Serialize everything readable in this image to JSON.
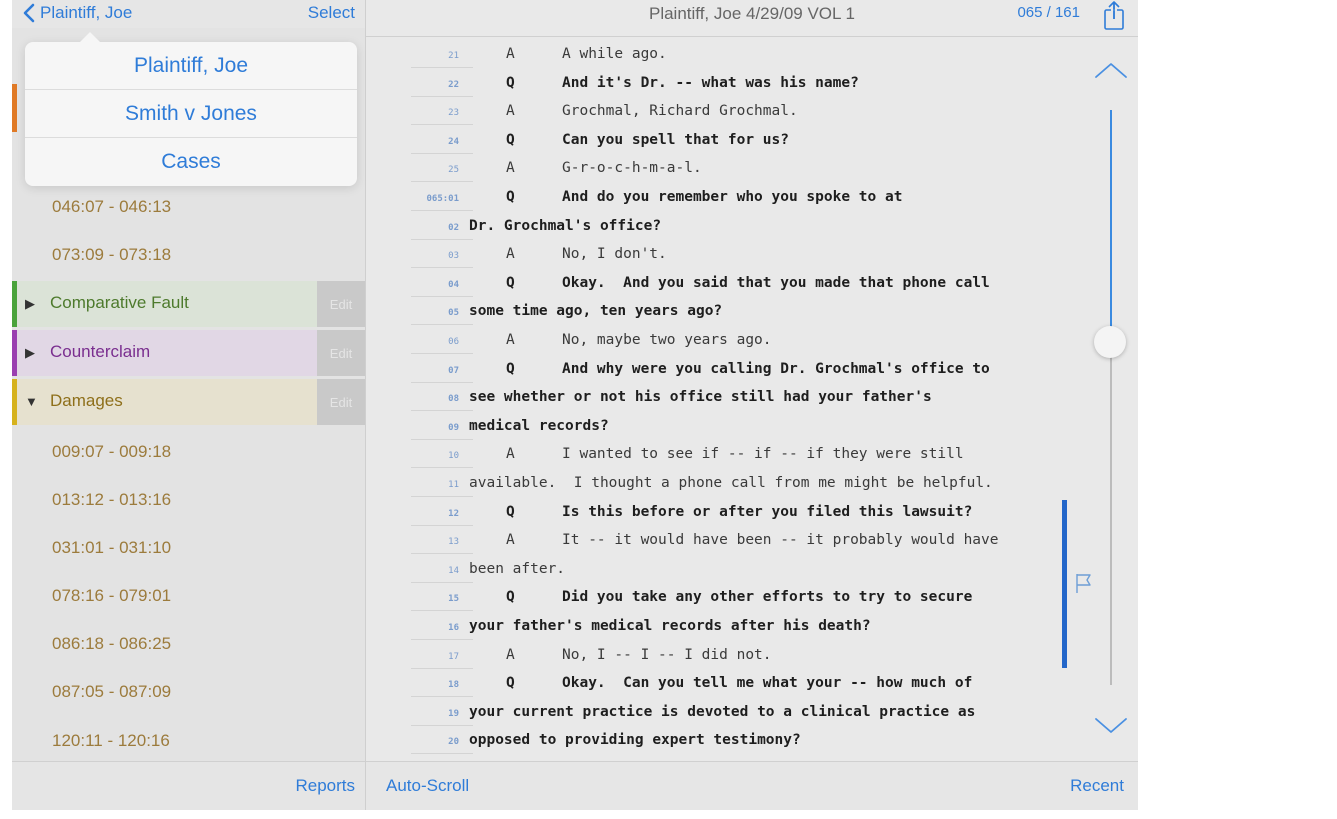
{
  "colors": {
    "accent": "#2f7cd8",
    "range_text": "#9c7b3c",
    "comparative_fault": "#4aa33b",
    "counterclaim": "#9a3fb0",
    "damages": "#d6b21d",
    "orange_marker": "#e07a26",
    "mark_bar": "#2366c9"
  },
  "sidebar": {
    "back_label": "Plaintiff, Joe",
    "select_label": "Select",
    "popover": {
      "items": [
        "Plaintiff, Joe",
        "Smith v Jones",
        "Cases"
      ]
    },
    "ranges_top": [
      "046:07 - 046:13",
      "073:09 - 073:18"
    ],
    "groups": [
      {
        "label": "Comparative Fault",
        "expanded": false,
        "edit": "Edit",
        "color": "#4aa33b"
      },
      {
        "label": "Counterclaim",
        "expanded": false,
        "edit": "Edit",
        "color": "#9a3fb0"
      },
      {
        "label": "Damages",
        "expanded": true,
        "edit": "Edit",
        "color": "#d6b21d"
      }
    ],
    "damages_ranges": [
      "009:07 - 009:18",
      "013:12 - 013:16",
      "031:01 - 031:10",
      "078:16 - 079:01",
      "086:18 - 086:25",
      "087:05 - 087:09",
      "120:11 - 120:16"
    ],
    "reports_label": "Reports"
  },
  "main": {
    "title": "Plaintiff, Joe 4/29/09 VOL 1",
    "page_counter": "065 / 161",
    "auto_scroll_label": "Auto-Scroll",
    "recent_label": "Recent",
    "scroll_position": 0.4,
    "lines": [
      {
        "ln": "21",
        "speaker": "A",
        "text": "A while ago.",
        "type": "a"
      },
      {
        "ln": "22",
        "speaker": "Q",
        "text": "And it's Dr. -- what was his name?",
        "type": "q"
      },
      {
        "ln": "23",
        "speaker": "A",
        "text": "Grochmal, Richard Grochmal.",
        "type": "a"
      },
      {
        "ln": "24",
        "speaker": "Q",
        "text": "Can you spell that for us?",
        "type": "q"
      },
      {
        "ln": "25",
        "speaker": "A",
        "text": "G-r-o-c-h-m-a-l.",
        "type": "a"
      },
      {
        "ln": "065:01",
        "speaker": "Q",
        "text": "And do you remember who you spoke to at",
        "type": "q"
      },
      {
        "ln": "02",
        "speaker": "",
        "text": "Dr. Grochmal's office?",
        "type": "q"
      },
      {
        "ln": "03",
        "speaker": "A",
        "text": "No, I don't.",
        "type": "a"
      },
      {
        "ln": "04",
        "speaker": "Q",
        "text": "Okay.  And you said that you made that phone call",
        "type": "q"
      },
      {
        "ln": "05",
        "speaker": "",
        "text": "some time ago, ten years ago?",
        "type": "q"
      },
      {
        "ln": "06",
        "speaker": "A",
        "text": "No, maybe two years ago.",
        "type": "a"
      },
      {
        "ln": "07",
        "speaker": "Q",
        "text": "And why were you calling Dr. Grochmal's office to",
        "type": "q"
      },
      {
        "ln": "08",
        "speaker": "",
        "text": "see whether or not his office still had your father's",
        "type": "q"
      },
      {
        "ln": "09",
        "speaker": "",
        "text": "medical records?",
        "type": "q"
      },
      {
        "ln": "10",
        "speaker": "A",
        "text": "I wanted to see if -- if -- if they were still",
        "type": "a"
      },
      {
        "ln": "11",
        "speaker": "",
        "text": "available.  I thought a phone call from me might be helpful.",
        "type": "a"
      },
      {
        "ln": "12",
        "speaker": "Q",
        "text": "Is this before or after you filed this lawsuit?",
        "type": "q"
      },
      {
        "ln": "13",
        "speaker": "A",
        "text": "It -- it would have been -- it probably would have",
        "type": "a"
      },
      {
        "ln": "14",
        "speaker": "",
        "text": "been after.",
        "type": "a"
      },
      {
        "ln": "15",
        "speaker": "Q",
        "text": "Did you take any other efforts to try to secure",
        "type": "q"
      },
      {
        "ln": "16",
        "speaker": "",
        "text": "your father's medical records after his death?",
        "type": "q"
      },
      {
        "ln": "17",
        "speaker": "A",
        "text": "No, I -- I -- I did not.",
        "type": "a"
      },
      {
        "ln": "18",
        "speaker": "Q",
        "text": "Okay.  Can you tell me what your -- how much of",
        "type": "q"
      },
      {
        "ln": "19",
        "speaker": "",
        "text": "your current practice is devoted to a clinical practice as",
        "type": "q"
      },
      {
        "ln": "20",
        "speaker": "",
        "text": "opposed to providing expert testimony?",
        "type": "q"
      }
    ]
  }
}
